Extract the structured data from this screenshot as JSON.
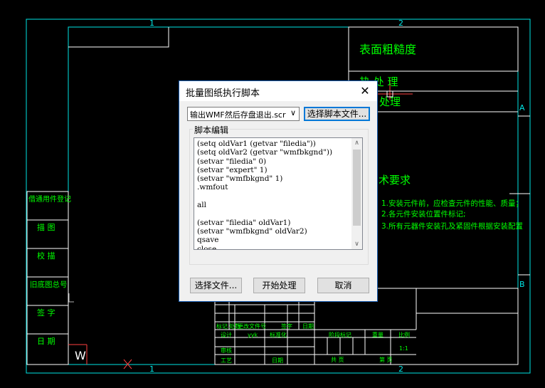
{
  "drawing": {
    "zone_cols": [
      "1",
      "2"
    ],
    "zone_rows": [
      "A",
      "B"
    ],
    "title_roughness": "表面粗糙度",
    "heat_treatment": "热 处 理",
    "surface_treatment": "处理",
    "tech_req_title": "术要求",
    "tech_req_lines": [
      "1.安装元件前，应检查元件的性能、质量；",
      "2.各元件安装位置件标记;",
      "3.所有元器件安装孔及紧固件根据安装配置"
    ],
    "left_labels": [
      "借通用件登记",
      "描 图",
      "校 描",
      "旧底图总号",
      "签 字",
      "日 期"
    ],
    "title_block": {
      "row_marks": [
        "标记",
        "处数",
        "更改文件号",
        "签字",
        "日期"
      ],
      "design": "设计",
      "designer": "yyk",
      "standardization": "标准化",
      "review": "审核",
      "process": "工艺",
      "date": "日期",
      "stage_mark": "阶段标记",
      "weight": "重量",
      "scale": "比例",
      "scale_value": "1:1",
      "total_pages": "共    页",
      "page_no": "第    页"
    },
    "w_marker": "W"
  },
  "dialog": {
    "title": "批量图纸执行脚本",
    "close_glyph": "✕",
    "script_select": {
      "value": "输出WMF然后存盘退出.scr",
      "arrow": "∨"
    },
    "choose_script_button": "选择脚本文件...",
    "group_label": "脚本编辑",
    "script_text": "(setq oldVar1 (getvar \"filedia\"))\n(setq oldVar2 (getvar \"wmfbkgnd\"))\n(setvar \"filedia\" 0)\n(setvar \"expert\" 1)\n(setvar \"wmfbkgnd\" 1)\n.wmfout\n\nall\n\n(setvar \"filedia\" oldVar1)\n(setvar \"wmfbkgnd\" oldVar2)\nqsave\nclose",
    "scroll_up": "∧",
    "scroll_down": "∨",
    "choose_files_button": "选择文件...",
    "start_button": "开始处理",
    "cancel_button": "取消"
  }
}
